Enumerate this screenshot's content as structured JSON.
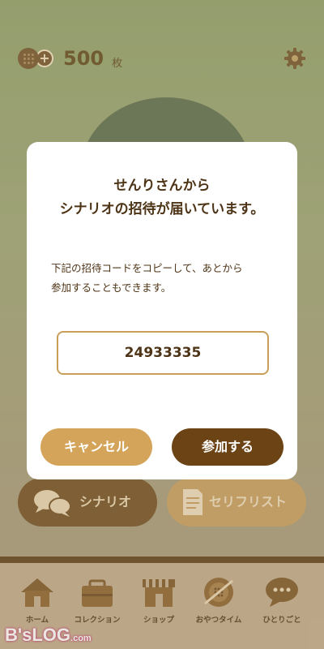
{
  "header": {
    "currency_amount": "500",
    "currency_unit": "枚",
    "icons": [
      "cookie-icon",
      "plus-icon",
      "gear-icon"
    ]
  },
  "dialog": {
    "title_line1": "せんりさんから",
    "title_line2": "シナリオの招待が届いています。",
    "body_line1": "下記の招待コードをコピーして、あとから",
    "body_line2": "参加することもできます。",
    "invite_code": "24933335",
    "cancel_label": "キャンセル",
    "join_label": "参加する"
  },
  "actions": {
    "scenario_label": "シナリオ",
    "serif_list_label": "セリフリスト"
  },
  "nav": {
    "items": [
      {
        "label": "ホーム",
        "icon": "home-icon"
      },
      {
        "label": "コレクション",
        "icon": "collection-icon"
      },
      {
        "label": "ショップ",
        "icon": "shop-icon"
      },
      {
        "label": "おやつタイム",
        "icon": "snack-icon"
      },
      {
        "label": "ひとりごと",
        "icon": "chat-icon"
      }
    ]
  },
  "watermark": {
    "text": "B'sLOG",
    "suffix": ".com"
  },
  "colors": {
    "accent_dark": "#6b4315",
    "accent_light": "#d4a45a",
    "text": "#4e3416"
  }
}
